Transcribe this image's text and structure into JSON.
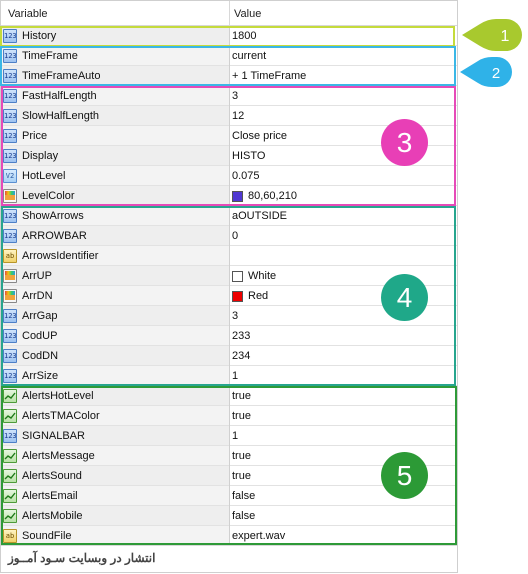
{
  "header": {
    "variable_label": "Variable",
    "value_label": "Value"
  },
  "colors": {
    "box1": "#c5db3c",
    "box2": "#3bb7e6",
    "box3": "#e64ab8",
    "box4": "#27a58e",
    "box5": "#2e9a38",
    "badge1": "#a8c92e",
    "badge2": "#2fb2e8",
    "badge3": "#e83fb6",
    "badge4": "#1fa889",
    "badge5": "#2c9a36"
  },
  "badges": [
    "1",
    "2",
    "3",
    "4",
    "5"
  ],
  "rows": [
    {
      "icon": "num",
      "name": "History",
      "value": "1800"
    },
    {
      "icon": "num",
      "name": "TimeFrame",
      "value": "current"
    },
    {
      "icon": "num",
      "name": "TimeFrameAuto",
      "value": "+ 1 TimeFrame"
    },
    {
      "icon": "num",
      "name": "FastHalfLength",
      "value": "3"
    },
    {
      "icon": "num",
      "name": "SlowHalfLength",
      "value": "12"
    },
    {
      "icon": "num",
      "name": "Price",
      "value": "Close price"
    },
    {
      "icon": "num",
      "name": "Display",
      "value": "HISTO"
    },
    {
      "icon": "dbl",
      "name": "HotLevel",
      "value": "0.075"
    },
    {
      "icon": "clr",
      "name": "LevelColor",
      "value": "80,60,210",
      "swatch": "#5038d2"
    },
    {
      "icon": "num",
      "name": "ShowArrows",
      "value": "aOUTSIDE"
    },
    {
      "icon": "num",
      "name": "ARROWBAR",
      "value": "0"
    },
    {
      "icon": "str",
      "name": "ArrowsIdentifier",
      "value": ""
    },
    {
      "icon": "clr",
      "name": "ArrUP",
      "value": "White",
      "swatch": "#ffffff"
    },
    {
      "icon": "clr",
      "name": "ArrDN",
      "value": "Red",
      "swatch": "#ee0000"
    },
    {
      "icon": "num",
      "name": "ArrGap",
      "value": "3"
    },
    {
      "icon": "num",
      "name": "CodUP",
      "value": "233"
    },
    {
      "icon": "num",
      "name": "CodDN",
      "value": "234"
    },
    {
      "icon": "num",
      "name": "ArrSize",
      "value": "1"
    },
    {
      "icon": "bool",
      "name": "AlertsHotLevel",
      "value": "true"
    },
    {
      "icon": "bool",
      "name": "AlertsTMAColor",
      "value": "true"
    },
    {
      "icon": "num",
      "name": "SIGNALBAR",
      "value": "1"
    },
    {
      "icon": "bool",
      "name": "AlertsMessage",
      "value": "true"
    },
    {
      "icon": "bool",
      "name": "AlertsSound",
      "value": "true"
    },
    {
      "icon": "bool",
      "name": "AlertsEmail",
      "value": "false"
    },
    {
      "icon": "bool",
      "name": "AlertsMobile",
      "value": "false"
    },
    {
      "icon": "str",
      "name": "SoundFile",
      "value": "expert.wav"
    }
  ],
  "icon_glyphs": {
    "num": "123",
    "dbl": "V2",
    "str": "ab",
    "bool": "",
    "clr": ""
  },
  "footer": {
    "text": "انتشار در وبسایت سـود آمــوز"
  }
}
